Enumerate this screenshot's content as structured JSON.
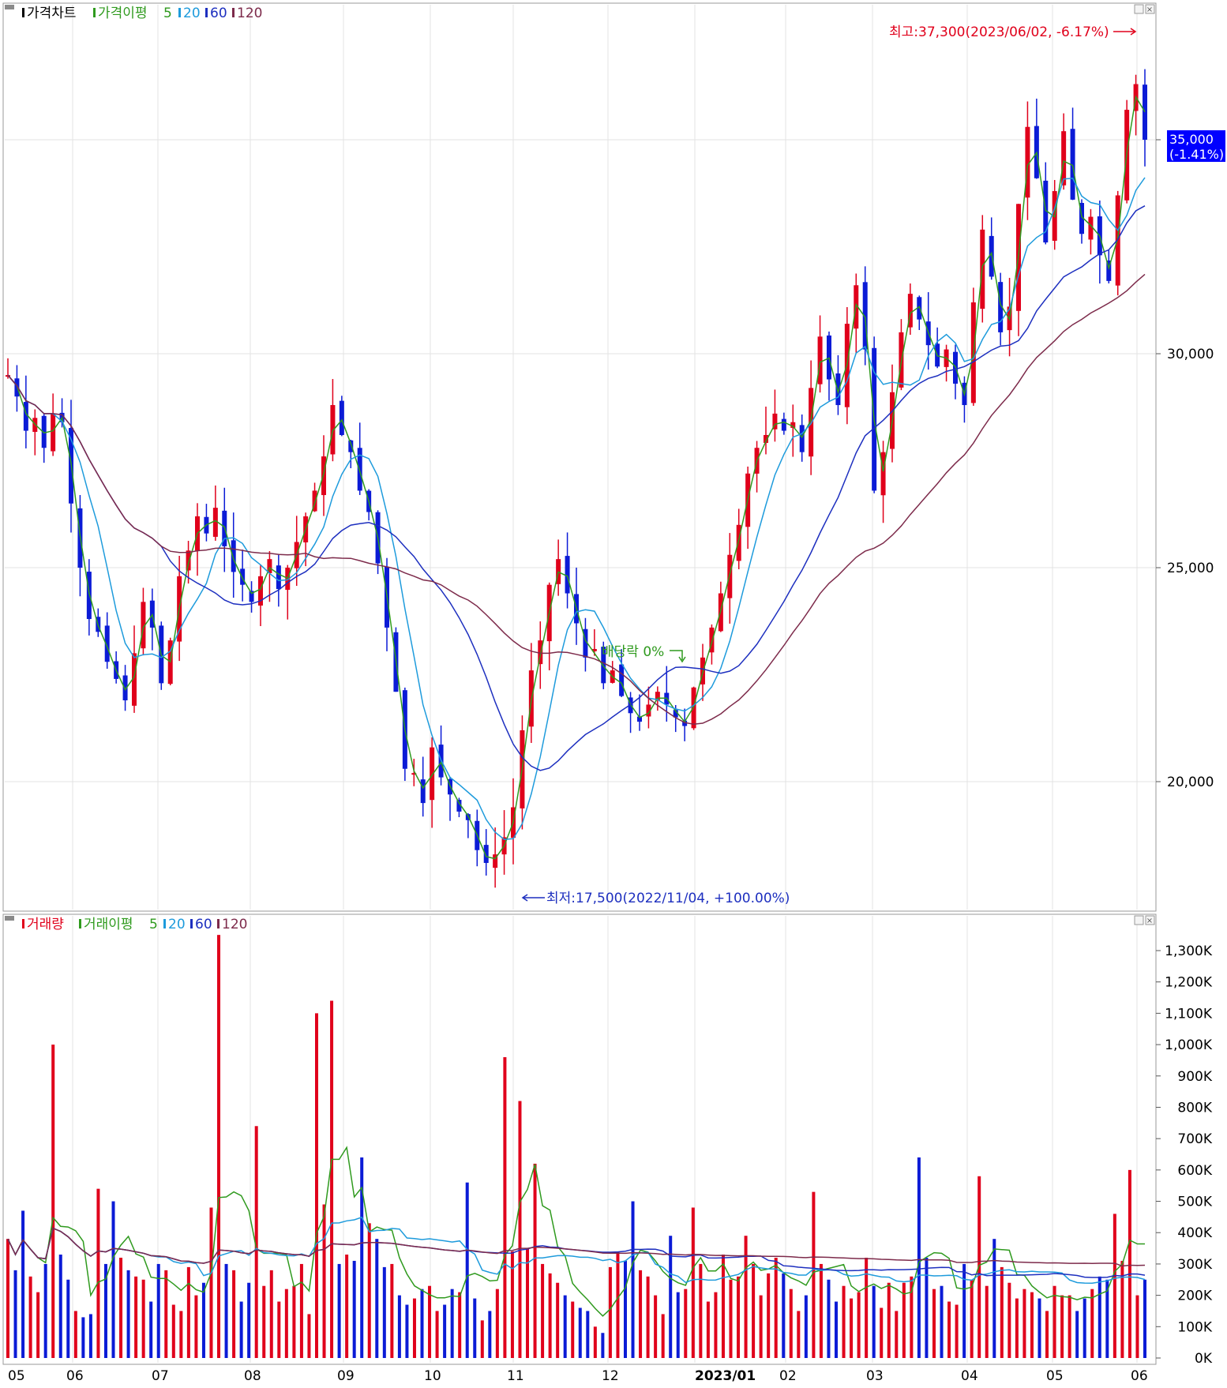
{
  "price_panel": {
    "legend": [
      "가격차트",
      "가격이평",
      "5",
      "20",
      "60",
      "120"
    ],
    "high_label": "최고:37,300(2023/06/02, -6.17%)",
    "low_label": "최저:17,500(2022/11/04, +100.00%)",
    "dividend_label": "배당락 0%",
    "current_price": "35,000",
    "current_change": "(-1.41%)"
  },
  "volume_panel": {
    "legend": [
      "거래량",
      "거래이평",
      "5",
      "20",
      "60",
      "120"
    ]
  },
  "x_axis": {
    "labels": [
      "05",
      "06",
      "07",
      "08",
      "09",
      "10",
      "11",
      "12",
      "2023/01",
      "02",
      "03",
      "04",
      "05",
      "06"
    ]
  },
  "colors": {
    "up": "#e0001b",
    "down": "#0b1bd6",
    "ma5": "#2f9a1e",
    "ma20": "#1e9bdc",
    "ma60": "#1d2fbf",
    "ma120": "#7d2b4b",
    "grid": "#e3e3e3",
    "highlight": "#0000ff"
  },
  "chart_data": [
    {
      "type": "candlestick",
      "title": "가격차트",
      "x": [
        "05",
        "06",
        "07",
        "08",
        "09",
        "10",
        "11",
        "12",
        "2023/01",
        "02",
        "03",
        "04",
        "05",
        "06"
      ],
      "y_ticks": [
        "20,000",
        "25,000",
        "30,000",
        "35,000"
      ],
      "ylim": [
        17000,
        38000
      ],
      "series": [
        {
          "name": "가격",
          "ohlc_closes": [
            29500,
            29000,
            28200,
            28500,
            27800,
            28600,
            28400,
            26500,
            25000,
            23800,
            23500,
            22800,
            22400,
            21900,
            23000,
            24200,
            23600,
            22300,
            23300,
            24800,
            25400,
            26200,
            25800,
            26400,
            25500,
            24900,
            24600,
            24200,
            24800,
            25200,
            24500,
            25000,
            25600,
            26200,
            26800,
            27600,
            28800,
            28100,
            27700,
            26800,
            26300,
            25100,
            23600,
            22100,
            20300,
            20200,
            19500,
            20800,
            20100,
            19700,
            19300,
            19100,
            18400,
            18100,
            18300,
            18700,
            19400,
            21200,
            22600,
            23300,
            24600,
            25200,
            24400,
            23700,
            22900,
            23100,
            22300,
            22600,
            22000,
            21600,
            21400,
            21800,
            22100,
            21800,
            21500,
            21300,
            22200,
            22900,
            23600,
            24400,
            25300,
            26000,
            27200,
            27800,
            28100,
            28600,
            28200,
            28400,
            27700,
            29200,
            30400,
            29400,
            28800,
            30700,
            31600,
            30100,
            26800,
            27700,
            29100,
            30500,
            31400,
            30800,
            30200,
            29700,
            30100,
            29300,
            28800,
            31200,
            32900,
            31800,
            30500,
            31100,
            33500,
            35300,
            34100,
            32600,
            33800,
            35200,
            33600,
            32800,
            33200,
            32300,
            31700,
            33700,
            35700,
            36300,
            35000
          ]
        }
      ],
      "high": 37300,
      "high_date": "2023/06/02",
      "low": 17500,
      "low_date": "2022/11/04",
      "moving_averages": [
        "5",
        "20",
        "60",
        "120"
      ]
    },
    {
      "type": "bar",
      "title": "거래량",
      "x": [
        "05",
        "06",
        "07",
        "08",
        "09",
        "10",
        "11",
        "12",
        "2023/01",
        "02",
        "03",
        "04",
        "05",
        "06"
      ],
      "y_ticks": [
        "0K",
        "100K",
        "200K",
        "300K",
        "400K",
        "500K",
        "600K",
        "700K",
        "800K",
        "900K",
        "1,000K",
        "1,100K",
        "1,200K",
        "1,300K"
      ],
      "ylim": [
        0,
        1350000
      ],
      "series": [
        {
          "name": "거래량",
          "values_k": [
            380,
            280,
            470,
            260,
            210,
            300,
            1000,
            330,
            250,
            150,
            130,
            140,
            540,
            300,
            500,
            320,
            280,
            260,
            250,
            180,
            300,
            280,
            170,
            150,
            290,
            200,
            240,
            480,
            1350,
            300,
            280,
            180,
            240,
            740,
            230,
            280,
            180,
            220,
            230,
            300,
            140,
            1100,
            490,
            1140,
            300,
            330,
            310,
            640,
            430,
            380,
            290,
            300,
            200,
            170,
            190,
            220,
            230,
            150,
            170,
            220,
            210,
            560,
            190,
            120,
            150,
            220,
            960,
            340,
            820,
            350,
            620,
            300,
            270,
            240,
            200,
            180,
            160,
            150,
            100,
            80,
            290,
            340,
            310,
            500,
            280,
            260,
            200,
            140,
            390,
            210,
            220,
            480,
            300,
            180,
            210,
            330,
            250,
            260,
            390,
            300,
            200,
            270,
            320,
            270,
            220,
            150,
            200,
            530,
            300,
            250,
            180,
            230,
            190,
            210,
            320,
            230,
            160,
            240,
            150,
            240,
            260,
            640,
            320,
            220,
            230,
            180,
            170,
            300,
            250,
            580,
            230,
            380,
            290,
            240,
            190,
            220,
            210,
            190,
            150,
            230,
            200,
            200,
            150,
            190,
            220,
            260,
            250,
            460,
            310,
            600,
            200,
            250
          ]
        }
      ],
      "moving_averages": [
        "5",
        "20",
        "60",
        "120"
      ]
    }
  ]
}
